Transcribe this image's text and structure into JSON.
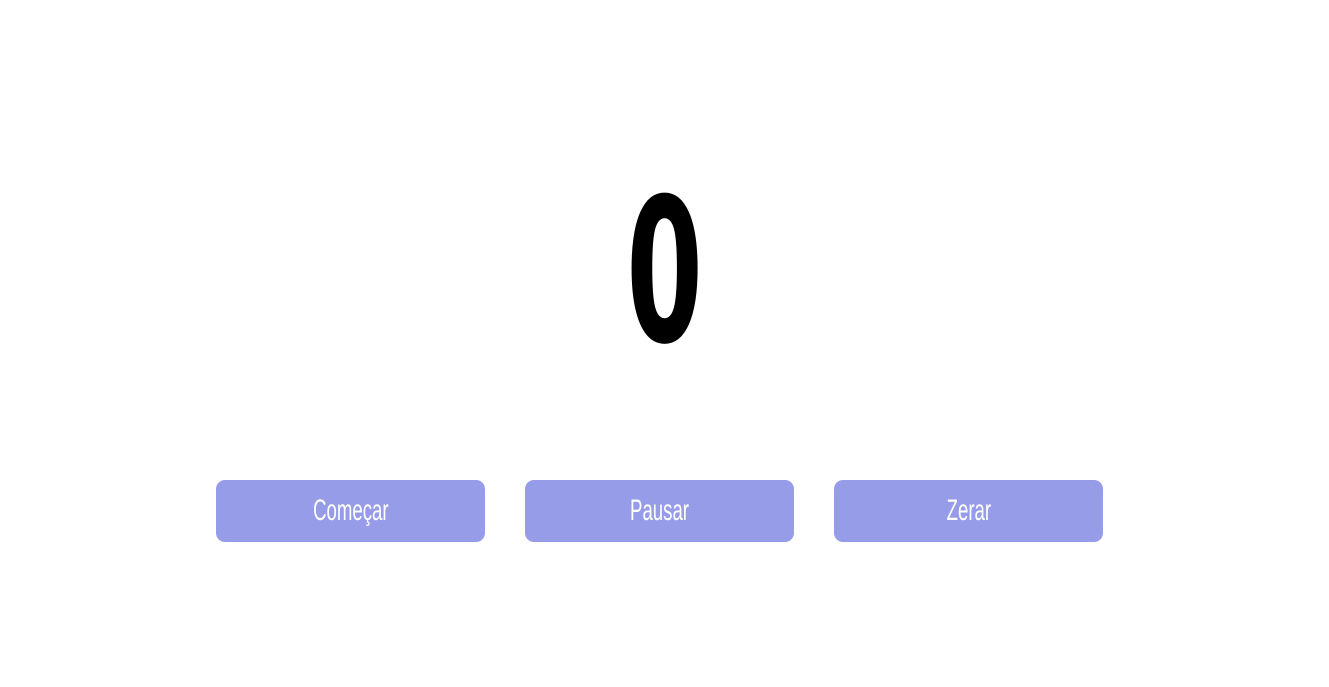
{
  "counter": {
    "value": "0"
  },
  "buttons": {
    "start_label": "Começar",
    "pause_label": "Pausar",
    "reset_label": "Zerar"
  },
  "colors": {
    "button_background": "#979ce9",
    "button_text": "#ffffff",
    "counter_text": "#000000",
    "page_background": "#ffffff"
  }
}
